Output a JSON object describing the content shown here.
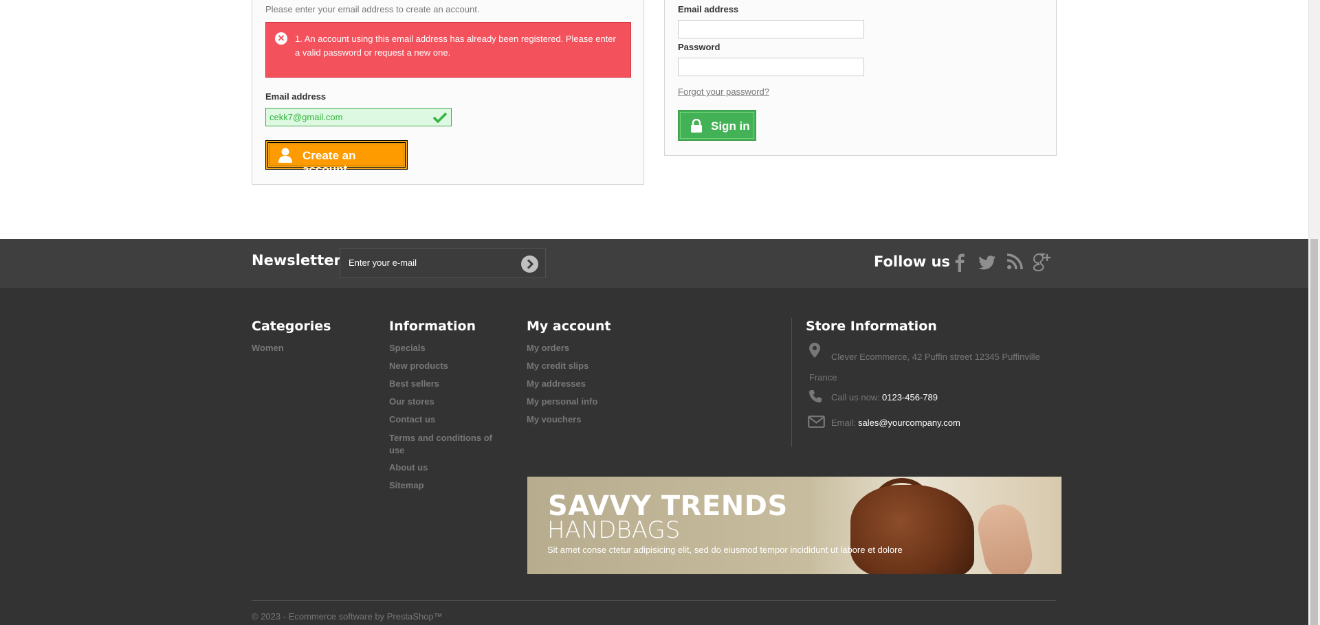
{
  "create_account": {
    "intro": "Please enter your email address to create an account.",
    "error_message": "1. An account using this email address has already been registered. Please enter a valid password or request a new one.",
    "email_label": "Email address",
    "email_value": "cekk7@gmail.com",
    "button_label": "Create an account"
  },
  "login": {
    "email_label": "Email address",
    "email_value": "",
    "password_label": "Password",
    "password_value": "",
    "forgot_link": "Forgot your password?",
    "button_label": "Sign in"
  },
  "newsletter": {
    "title": "Newsletter",
    "placeholder": "Enter your e-mail"
  },
  "follow_us": {
    "title": "Follow us",
    "networks": [
      "facebook-icon",
      "twitter-icon",
      "rss-icon",
      "google-plus-icon"
    ]
  },
  "footer": {
    "categories": {
      "title": "Categories",
      "items": [
        "Women"
      ]
    },
    "information": {
      "title": "Information",
      "items": [
        "Specials",
        "New products",
        "Best sellers",
        "Our stores",
        "Contact us",
        "Terms and conditions of use",
        "About us",
        "Sitemap"
      ]
    },
    "my_account": {
      "title": "My account",
      "items": [
        "My orders",
        "My credit slips",
        "My addresses",
        "My personal info",
        "My vouchers"
      ]
    },
    "store": {
      "title": "Store Information",
      "address": "Clever Ecommerce, 42 Puffin street 12345 Puffinville France",
      "call_label": "Call us now:",
      "phone": "0123-456-789",
      "email_label": "Email:",
      "email": "sales@yourcompany.com"
    },
    "banner": {
      "heading": "SAVVY TRENDS",
      "subheading": "HANDBAGS",
      "text": "Sit amet conse ctetur adipisicing elit, sed do eiusmod tempor incididunt ut labore et dolore"
    },
    "copyright": "© 2023 - Ecommerce software by PrestaShop™"
  },
  "colors": {
    "error": "#f3515c",
    "success": "#43b155",
    "create_button": "#fd9b00",
    "footer": "#333333",
    "newsletter_band": "#3f3f3f"
  }
}
